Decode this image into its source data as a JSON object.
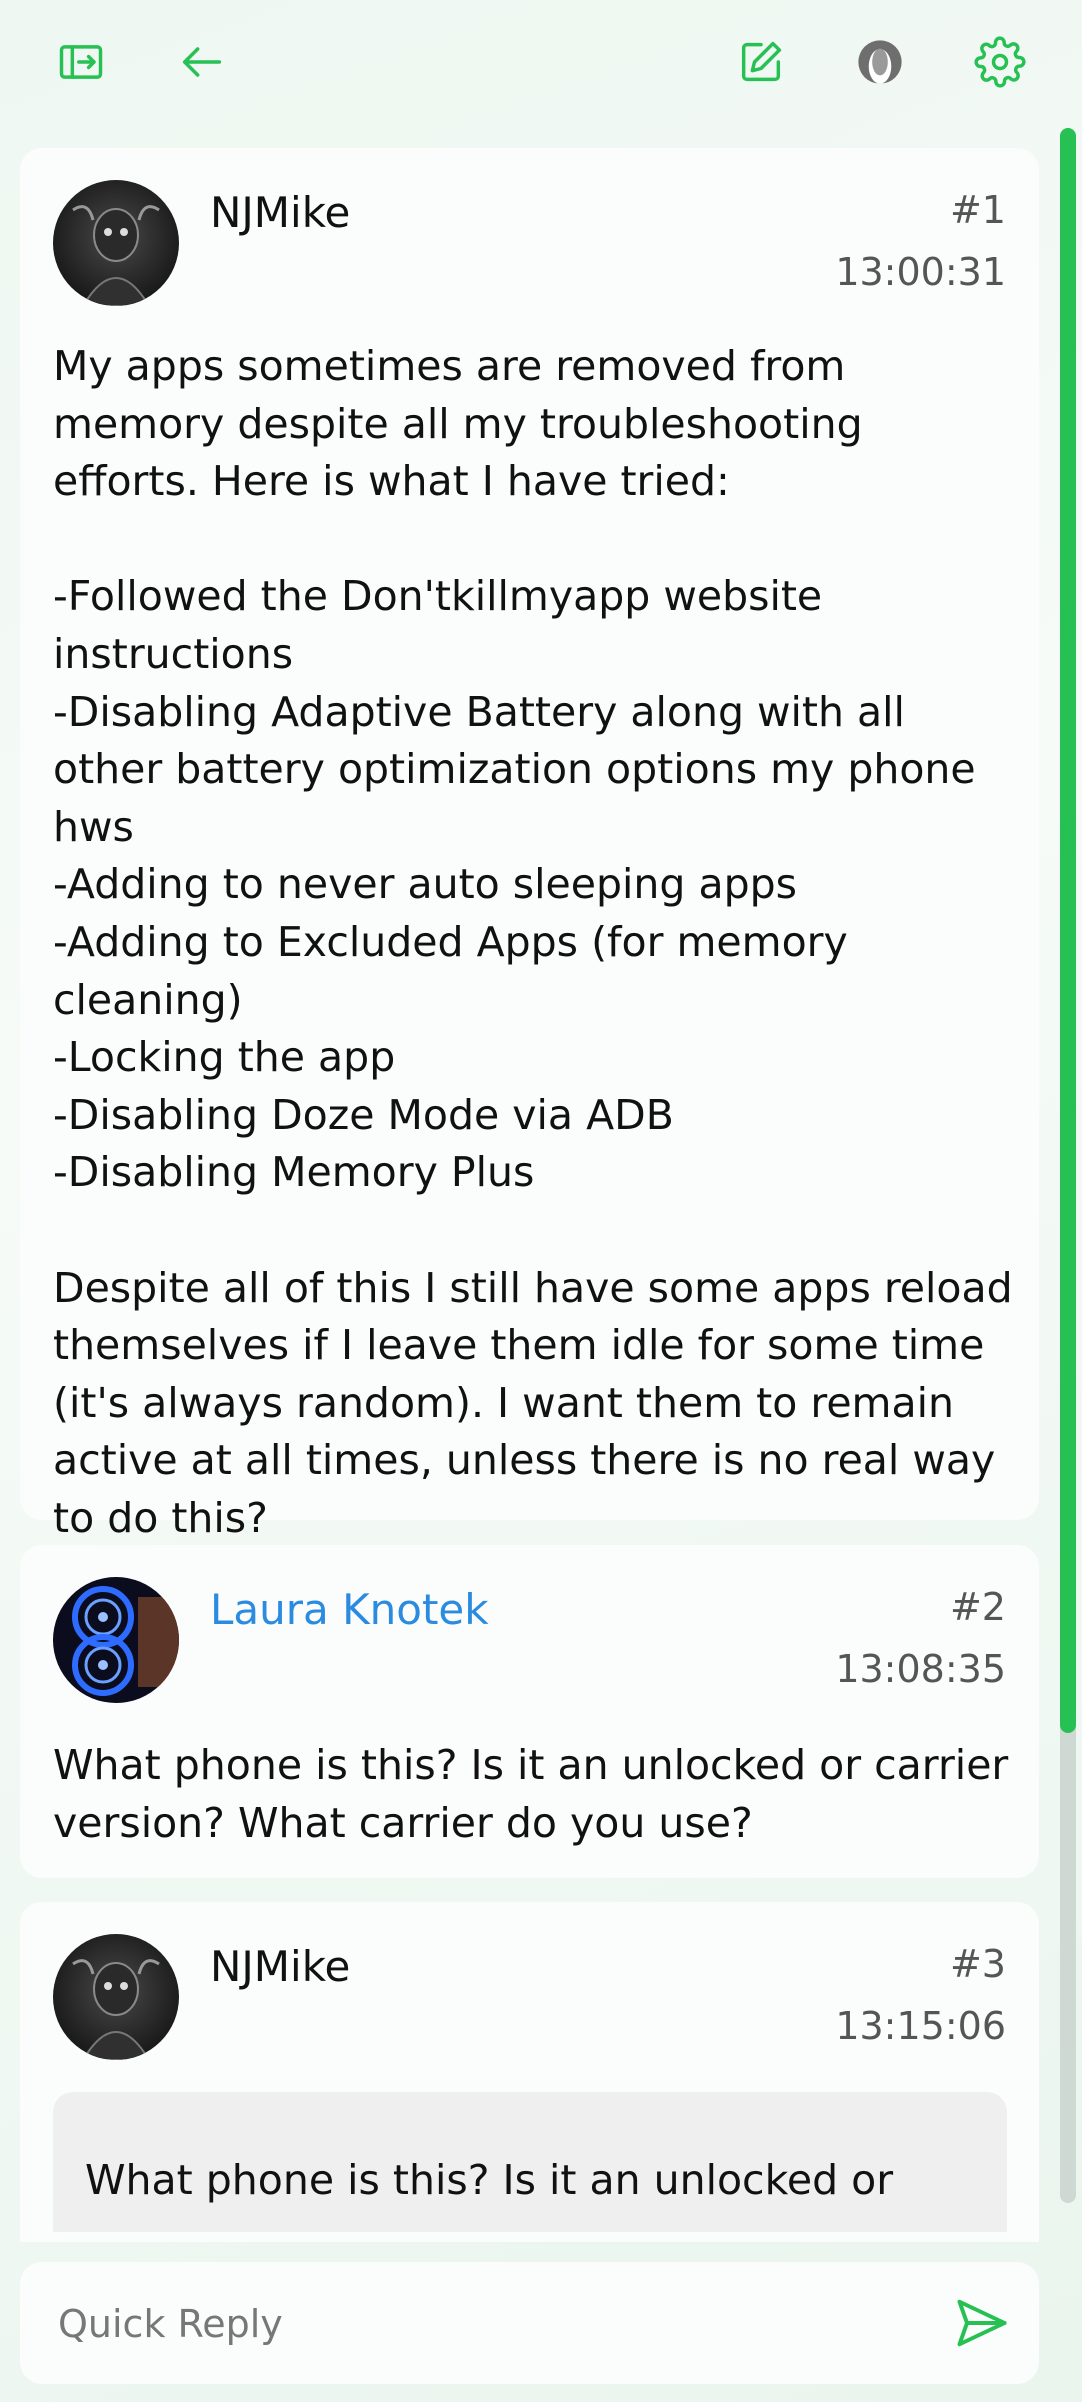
{
  "toolbar": {
    "sidebar_icon": "sidebar-toggle-icon",
    "back_icon": "arrow-left-icon",
    "compose_icon": "edit-icon",
    "profile_icon": "user-avatar-icon",
    "settings_icon": "gear-icon"
  },
  "posts": [
    {
      "author": "NJMike",
      "number": "#1",
      "time": "13:00:31",
      "body": "My apps sometimes are removed from memory despite all my troubleshooting efforts. Here is what I have tried:\n\n-Followed the Don'tkillmyapp website instructions\n-Disabling Adaptive Battery along with all other battery optimization options my phone hws\n-Adding to never auto sleeping apps\n-Adding to Excluded Apps (for memory cleaning)\n-Locking the app\n-Disabling Doze Mode via ADB\n-Disabling Memory Plus\n\nDespite all of this I still have some apps reload themselves if I leave them idle for some time (it's always random). I want them to remain active at all times, unless there is no real way to do this?"
    },
    {
      "author": "Laura Knotek",
      "number": "#2",
      "time": "13:08:35",
      "body": "What phone is this? Is it an unlocked or carrier version? What carrier do you use?"
    },
    {
      "author": "NJMike",
      "number": "#3",
      "time": "13:15:06",
      "quote": "What phone is this? Is it an unlocked or"
    }
  ],
  "reply": {
    "placeholder": "Quick Reply",
    "send_icon": "send-icon"
  },
  "colors": {
    "accent": "#27c052",
    "link": "#2a8be0"
  }
}
